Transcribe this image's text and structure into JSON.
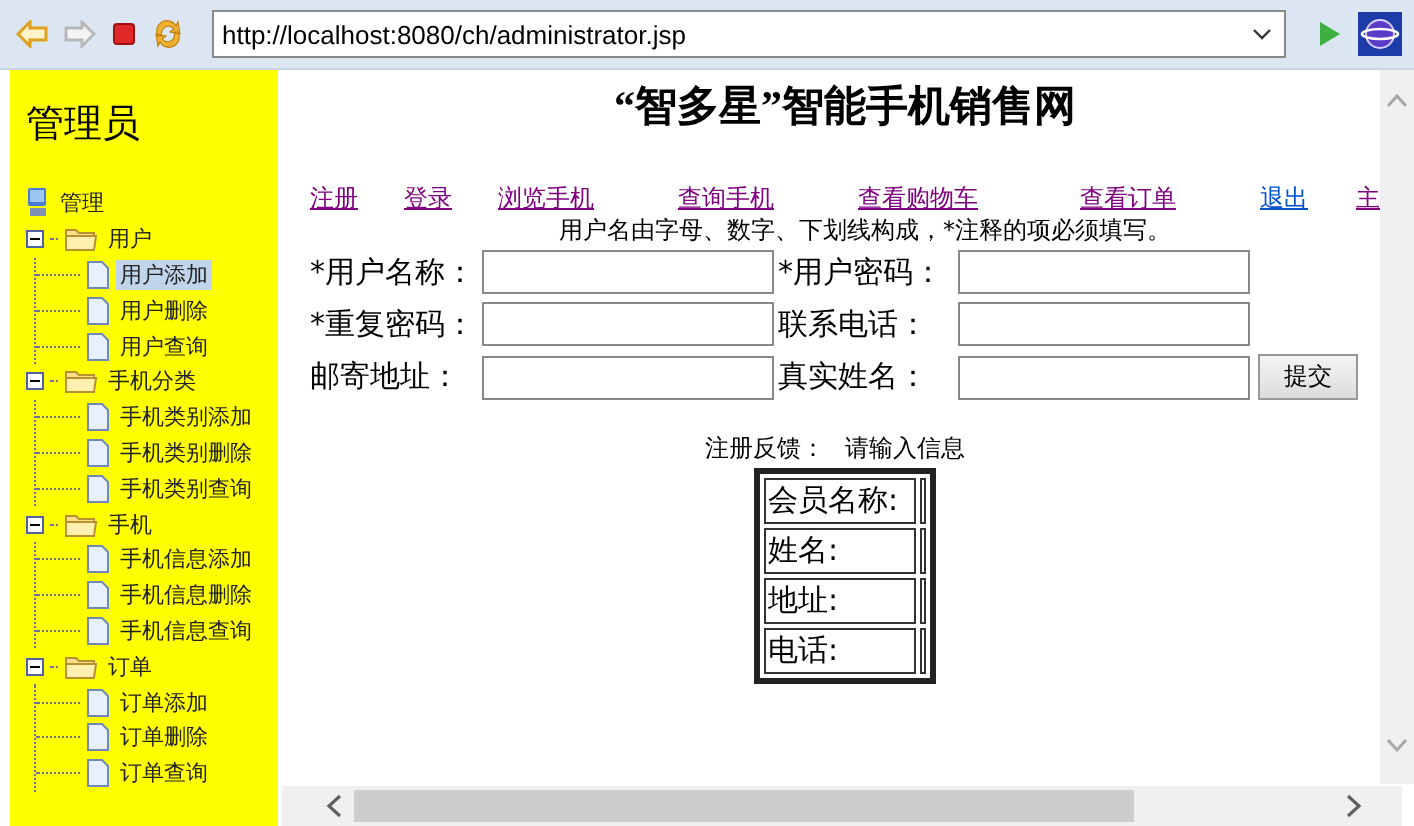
{
  "toolbar": {
    "address": "http://localhost:8080/ch/administrator.jsp"
  },
  "sidebar": {
    "title": "管理员",
    "tree": {
      "label": "管理",
      "children": [
        {
          "label": "用户",
          "expanded": true,
          "children": [
            {
              "label": "用户添加",
              "selected": true
            },
            {
              "label": "用户删除",
              "selected": false
            },
            {
              "label": "用户查询",
              "selected": false
            }
          ]
        },
        {
          "label": "手机分类",
          "expanded": true,
          "children": [
            {
              "label": "手机类别添加",
              "selected": false
            },
            {
              "label": "手机类别删除",
              "selected": false
            },
            {
              "label": "手机类别查询",
              "selected": false
            }
          ]
        },
        {
          "label": "手机",
          "expanded": true,
          "children": [
            {
              "label": "手机信息添加",
              "selected": false
            },
            {
              "label": "手机信息删除",
              "selected": false
            },
            {
              "label": "手机信息查询",
              "selected": false
            }
          ]
        },
        {
          "label": "订单",
          "expanded": true,
          "children": [
            {
              "label": "订单添加",
              "selected": false
            },
            {
              "label": "订单删除",
              "selected": false
            },
            {
              "label": "订单查询",
              "selected": false
            }
          ]
        }
      ]
    }
  },
  "page": {
    "title": "“智多星”智能手机销售网",
    "links": [
      {
        "label": "注册",
        "visited": true
      },
      {
        "label": "登录",
        "visited": true
      },
      {
        "label": "浏览手机",
        "visited": true
      },
      {
        "label": "查询手机",
        "visited": true
      },
      {
        "label": "查看购物车",
        "visited": true
      },
      {
        "label": "查看订单",
        "visited": true
      },
      {
        "label": "退出",
        "visited": false
      },
      {
        "label": "主",
        "visited": true
      }
    ],
    "hint": "用户名由字母、数字、下划线构成，*注释的项必须填写。",
    "form": [
      [
        {
          "label": "*用户名称："
        },
        {
          "label": "*用户密码："
        }
      ],
      [
        {
          "label": "*重复密码："
        },
        {
          "label": "联系电话："
        }
      ],
      [
        {
          "label": "邮寄地址："
        },
        {
          "label": "真实姓名："
        }
      ]
    ],
    "submit": "提交",
    "feedback_label": "注册反馈：",
    "feedback_value": "请输入信息",
    "member_table": [
      "会员名称:",
      "姓名:",
      "地址:",
      "电话:"
    ]
  }
}
